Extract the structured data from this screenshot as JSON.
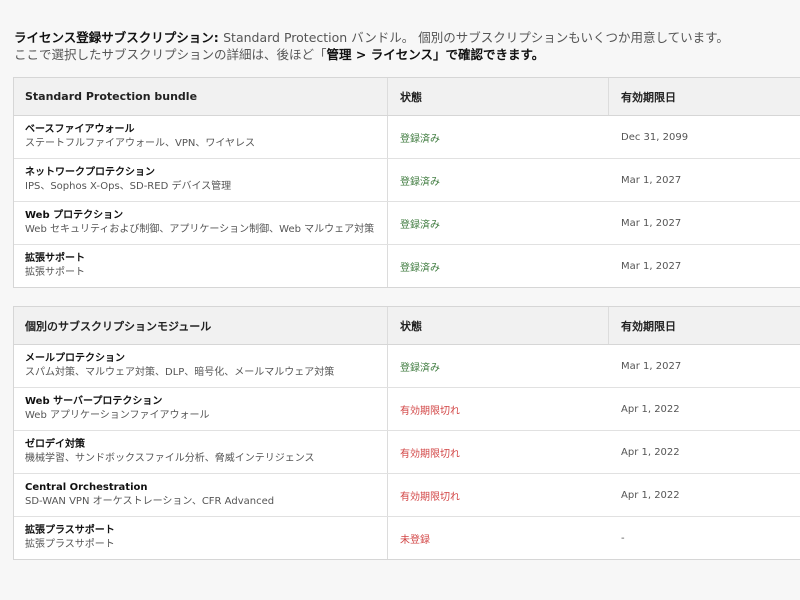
{
  "intro": {
    "title": "ライセンス登録サブスクリプション",
    "sep": ": ",
    "text1": "Standard Protection バンドル。 個別のサブスクリプションもいくつか用意しています。",
    "text2_a": "ここで選択したサブスクリプションの詳細は、後ほど「",
    "text2_path": "管理 > ライセンス",
    "text2_b": "」で確認できます。"
  },
  "bundle": {
    "header": {
      "name": "Standard Protection bundle",
      "status": "状態",
      "expiry": "有効期限日"
    },
    "rows": [
      {
        "name": "ベースファイアウォール",
        "desc": "ステートフルファイアウォール、VPN、ワイヤレス",
        "status": "登録済み",
        "date": "Dec 31, 2099"
      },
      {
        "name": "ネットワークプロテクション",
        "desc": "IPS、Sophos X-Ops、SD-RED デバイス管理",
        "status": "登録済み",
        "date": "Mar 1, 2027"
      },
      {
        "name": "Web プロテクション",
        "desc": "Web セキュリティおよび制御、アプリケーション制御、Web マルウェア対策",
        "status": "登録済み",
        "date": "Mar 1, 2027"
      },
      {
        "name": "拡張サポート",
        "desc": "拡張サポート",
        "status": "登録済み",
        "date": "Mar 1, 2027"
      }
    ]
  },
  "modules": {
    "header": {
      "name": "個別のサブスクリプションモジュール",
      "status": "状態",
      "expiry": "有効期限日"
    },
    "rows": [
      {
        "name": "メールプロテクション",
        "desc": "スパム対策、マルウェア対策、DLP、暗号化、メールマルウェア対策",
        "status": "登録済み",
        "date": "Mar 1, 2027"
      },
      {
        "name": "Web サーバープロテクション",
        "desc": "Web アプリケーションファイアウォール",
        "status": "有効期限切れ",
        "date": "Apr 1, 2022"
      },
      {
        "name": "ゼロデイ対策",
        "desc": "機械学習、サンドボックスファイル分析、脅威インテリジェンス",
        "status": "有効期限切れ",
        "date": "Apr 1, 2022"
      },
      {
        "name": "Central Orchestration",
        "desc": "SD-WAN VPN オーケストレーション、CFR Advanced",
        "status": "有効期限切れ",
        "date": "Apr 1, 2022"
      },
      {
        "name": "拡張プラスサポート",
        "desc": "拡張プラスサポート",
        "status": "未登録",
        "date": "-"
      }
    ]
  },
  "colors": {
    "registered": "#3d7a3d",
    "expired": "#d24444",
    "header_bg": "#f1f1f1",
    "page_bg": "#f7f7f7"
  }
}
